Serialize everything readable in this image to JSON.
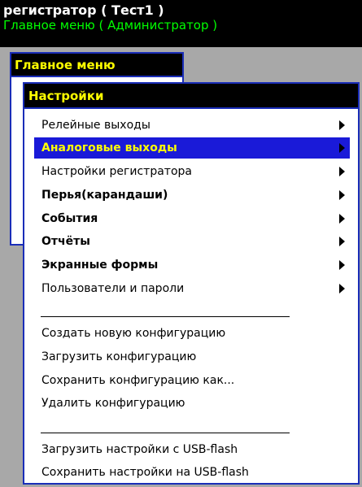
{
  "header": {
    "title": "регистратор ( Тест1 )",
    "subtitle": "Главное меню ( Администратор )"
  },
  "main_menu": {
    "title": "Главное меню"
  },
  "settings": {
    "title": "Настройки",
    "items": [
      {
        "label": "Релейные выходы",
        "bold": false,
        "submenu": true,
        "selected": false
      },
      {
        "label": "Аналоговые выходы",
        "bold": true,
        "submenu": true,
        "selected": true
      },
      {
        "label": "Настройки регистратора",
        "bold": false,
        "submenu": true,
        "selected": false
      },
      {
        "label": "Перья(карандаши)",
        "bold": true,
        "submenu": true,
        "selected": false
      },
      {
        "label": "События",
        "bold": true,
        "submenu": true,
        "selected": false
      },
      {
        "label": "Отчёты",
        "bold": true,
        "submenu": true,
        "selected": false
      },
      {
        "label": "Экранные формы",
        "bold": true,
        "submenu": true,
        "selected": false
      },
      {
        "label": "Пользователи и пароли",
        "bold": false,
        "submenu": true,
        "selected": false
      }
    ],
    "config_actions": [
      {
        "label": "Создать новую конфигурацию"
      },
      {
        "label": "Загрузить конфигурацию"
      },
      {
        "label": "Сохранить конфигурацию как..."
      },
      {
        "label": "Удалить конфигурацию"
      }
    ],
    "usb_actions": [
      {
        "label": "Загрузить настройки с USB-flash"
      },
      {
        "label": "Сохранить настройки на USB-flash"
      }
    ]
  }
}
